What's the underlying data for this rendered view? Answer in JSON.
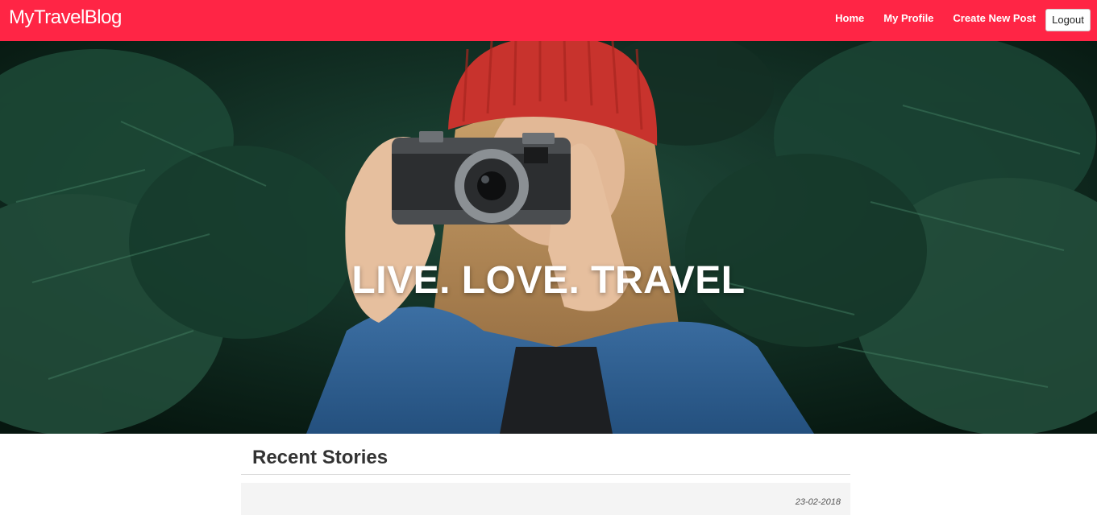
{
  "navbar": {
    "brand": "MyTravelBlog",
    "links": [
      "Home",
      "My Profile",
      "Create New Post"
    ],
    "logout_label": "Logout",
    "background_color": "#ff2545"
  },
  "hero": {
    "title": "LIVE. LOVE. TRAVEL"
  },
  "main": {
    "section_title": "Recent Stories",
    "stories": [
      {
        "date": "23-02-2018"
      }
    ]
  }
}
